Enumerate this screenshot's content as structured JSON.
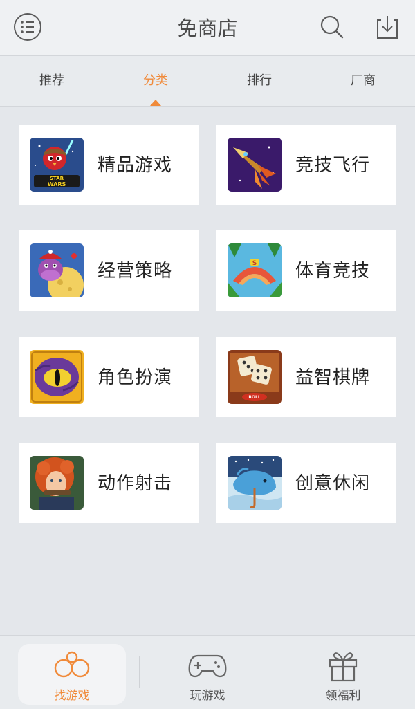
{
  "header": {
    "title": "免商店"
  },
  "icons": {
    "menu": "menu-list-icon",
    "search": "search-icon",
    "download": "download-icon"
  },
  "tabs": [
    {
      "label": "推荐",
      "active": false
    },
    {
      "label": "分类",
      "active": true
    },
    {
      "label": "排行",
      "active": false
    },
    {
      "label": "厂商",
      "active": false
    }
  ],
  "categories": [
    {
      "label": "精品游戏",
      "icon": "star-wars-birds-game-icon"
    },
    {
      "label": "竞技飞行",
      "icon": "rocket-game-icon"
    },
    {
      "label": "经营策略",
      "icon": "hippo-cheese-game-icon"
    },
    {
      "label": "体育竞技",
      "icon": "glider-game-icon"
    },
    {
      "label": "角色扮演",
      "icon": "dragon-eye-game-icon"
    },
    {
      "label": "益智棋牌",
      "icon": "dice-roll-game-icon"
    },
    {
      "label": "动作射击",
      "icon": "red-hair-archer-game-icon"
    },
    {
      "label": "创意休闲",
      "icon": "whale-umbrella-game-icon"
    }
  ],
  "bottom_nav": [
    {
      "label": "找游戏",
      "icon": "find-games-icon",
      "active": true
    },
    {
      "label": "玩游戏",
      "icon": "gamepad-icon",
      "active": false
    },
    {
      "label": "领福利",
      "icon": "gift-icon",
      "active": false
    }
  ],
  "colors": {
    "accent": "#f08a3a",
    "background": "#e4e7eb",
    "card": "#ffffff",
    "text": "#222222"
  }
}
